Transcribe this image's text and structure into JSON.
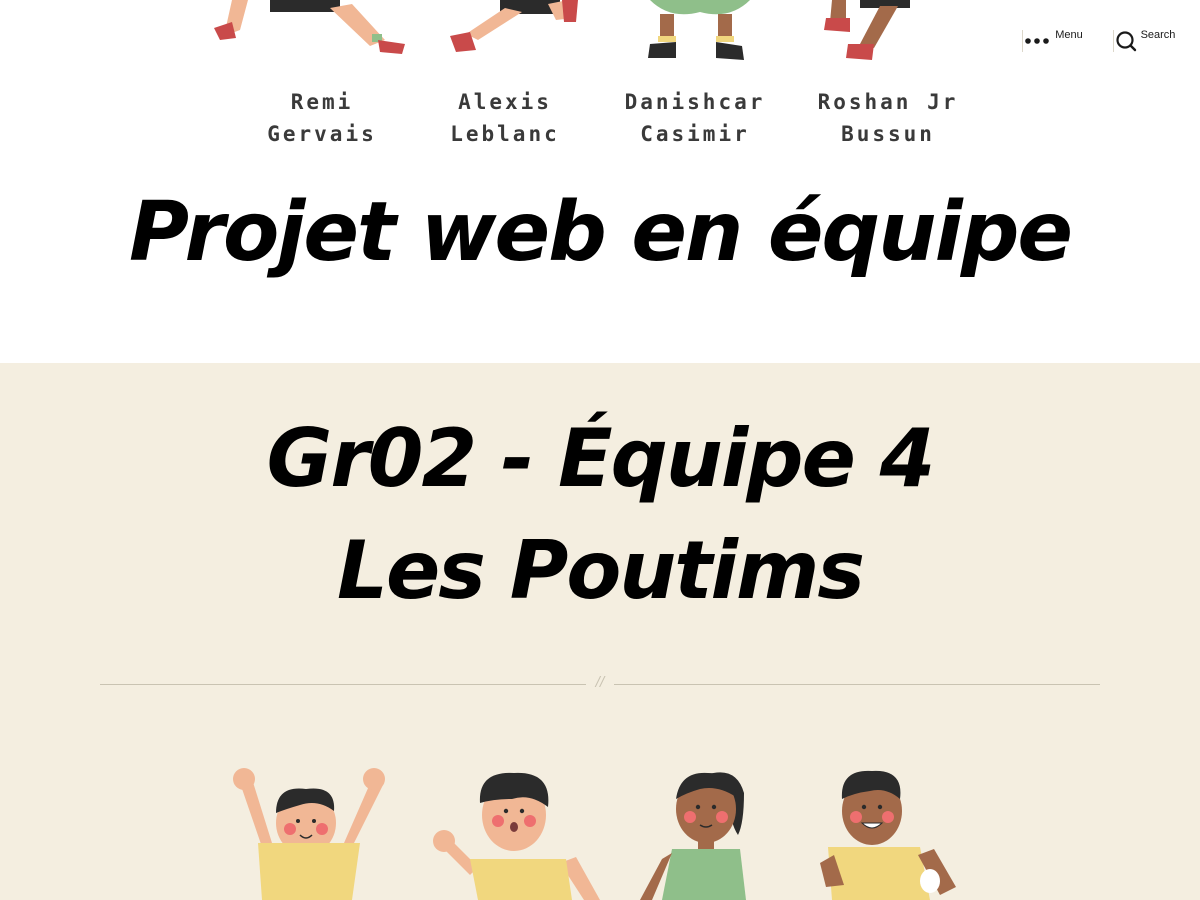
{
  "header": {
    "member_names": [
      {
        "first": "Remi",
        "last": "Gervais"
      },
      {
        "first": "Alexis",
        "last": "Leblanc"
      },
      {
        "first": "Danishcar",
        "last": "Casimir"
      },
      {
        "first": "Roshan Jr",
        "last": "Bussun"
      }
    ],
    "menu_label": "Menu",
    "search_label": "Search",
    "site_title": "Projet web en équipe"
  },
  "entry": {
    "title_line_1": "Gr02 - Équipe 4",
    "title_line_2": "Les Poutims",
    "separator": "//"
  },
  "colors": {
    "content_background": "#f4eee0",
    "shirt_yellow": "#f1d77e",
    "dress_green": "#8fbf8a",
    "skin_light": "#f1b795",
    "skin_dark": "#a36a4a",
    "hair": "#2b2b2b"
  }
}
